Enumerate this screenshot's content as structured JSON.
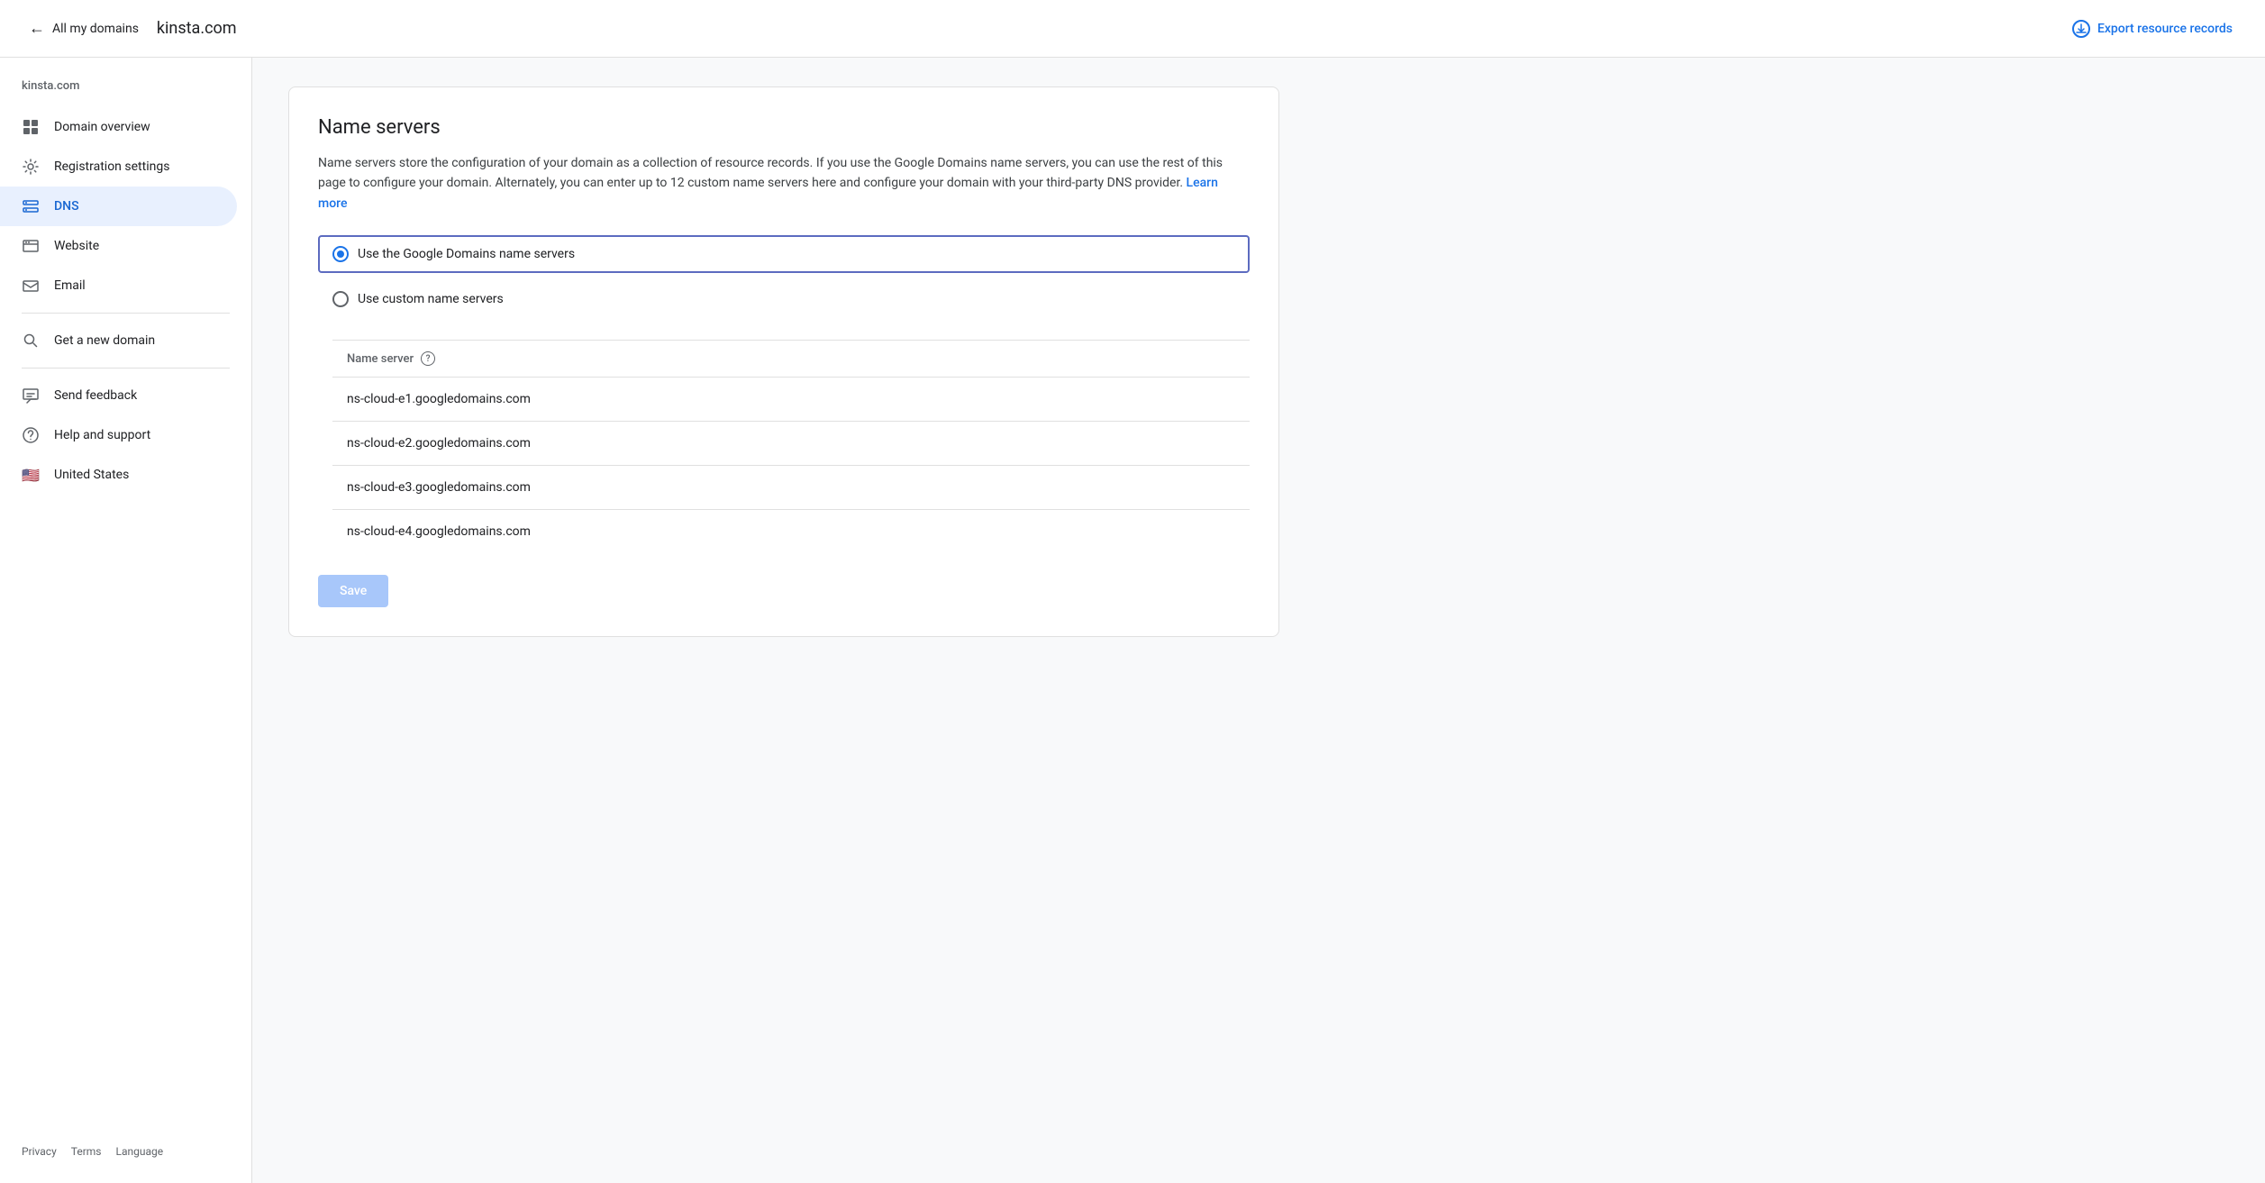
{
  "header": {
    "back_label": "All my domains",
    "domain": "kinsta.com",
    "export_label": "Export resource records"
  },
  "sidebar": {
    "domain": "kinsta.com",
    "items": [
      {
        "id": "domain-overview",
        "label": "Domain overview",
        "icon": "grid"
      },
      {
        "id": "registration-settings",
        "label": "Registration settings",
        "icon": "gear"
      },
      {
        "id": "dns",
        "label": "DNS",
        "icon": "dns",
        "active": true
      },
      {
        "id": "website",
        "label": "Website",
        "icon": "website"
      },
      {
        "id": "email",
        "label": "Email",
        "icon": "email"
      }
    ],
    "secondary_items": [
      {
        "id": "get-new-domain",
        "label": "Get a new domain",
        "icon": "search"
      },
      {
        "id": "send-feedback",
        "label": "Send feedback",
        "icon": "feedback"
      },
      {
        "id": "help-support",
        "label": "Help and support",
        "icon": "help"
      },
      {
        "id": "united-states",
        "label": "United States",
        "icon": "flag"
      }
    ],
    "footer_links": [
      {
        "id": "privacy",
        "label": "Privacy"
      },
      {
        "id": "terms",
        "label": "Terms"
      },
      {
        "id": "language",
        "label": "Language"
      }
    ]
  },
  "main": {
    "card": {
      "title": "Name servers",
      "description": "Name servers store the configuration of your domain as a collection of resource records. If you use the Google Domains name servers, you can use the rest of this page to configure your domain. Alternately, you can enter up to 12 custom name servers here and configure your domain with your third-party DNS provider.",
      "learn_more_label": "Learn more",
      "radio_options": [
        {
          "id": "google-ns",
          "label": "Use the Google Domains name servers",
          "selected": true
        },
        {
          "id": "custom-ns",
          "label": "Use custom name servers",
          "selected": false
        }
      ],
      "ns_table": {
        "header": "Name server",
        "rows": [
          {
            "value": "ns-cloud-e1.googledomains.com"
          },
          {
            "value": "ns-cloud-e2.googledomains.com"
          },
          {
            "value": "ns-cloud-e3.googledomains.com"
          },
          {
            "value": "ns-cloud-e4.googledomains.com"
          }
        ]
      },
      "save_label": "Save"
    }
  }
}
